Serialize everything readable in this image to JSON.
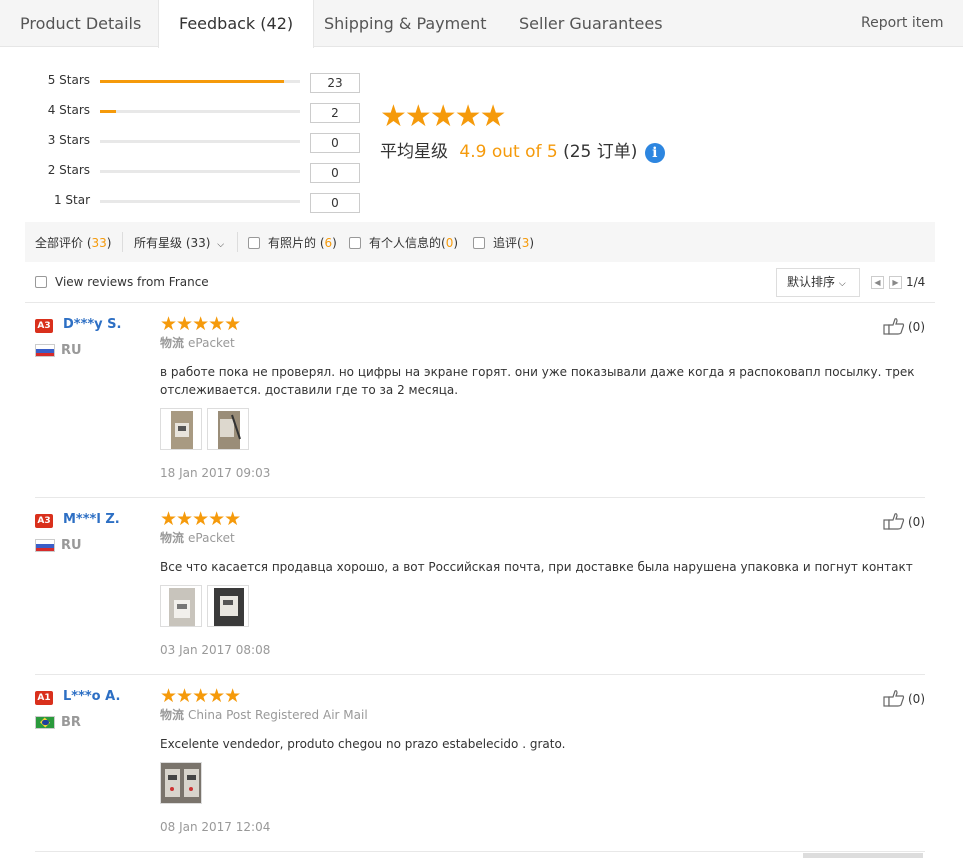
{
  "tabs": {
    "product_details": "Product Details",
    "feedback": "Feedback (42)",
    "shipping": "Shipping & Payment",
    "seller": "Seller Guarantees",
    "report": "Report item"
  },
  "rating_summary": {
    "rows": [
      {
        "label": "5 Stars",
        "count": "23",
        "fill_fraction": 0.92
      },
      {
        "label": "4 Stars",
        "count": "2",
        "fill_fraction": 0.08
      },
      {
        "label": "3 Stars",
        "count": "0",
        "fill_fraction": 0
      },
      {
        "label": "2 Stars",
        "count": "0",
        "fill_fraction": 0
      },
      {
        "label": "1 Star",
        "count": "0",
        "fill_fraction": 0
      }
    ],
    "stars_glyph": "★★★★★",
    "avg_label": "平均星级",
    "avg_score": "4.9 out of 5",
    "avg_orders": "(25 订单)",
    "info_glyph": "i"
  },
  "filters": {
    "all_label": "全部评价 (",
    "all_count": "33",
    "all_close": ")",
    "stars_select": "所有星级 (33)",
    "photos_label": "有照片的 (",
    "photos_count": "6",
    "photos_close": ")",
    "personal_label": "有个人信息的(",
    "personal_count": "0",
    "personal_close": ")",
    "followup_label": "追评(",
    "followup_count": "3",
    "followup_close": ")"
  },
  "sort": {
    "france_label": "View reviews from France",
    "sort_label": "默认排序",
    "prev_glyph": "◀",
    "next_glyph": "▶",
    "page_text": "1/4"
  },
  "reviews": [
    {
      "level": "A3",
      "user": "D***y S.",
      "country": "RU",
      "stars": "★★★★★",
      "logistics_label": "物流",
      "logistics": "ePacket",
      "text": "в работе пока не проверял. но цифры на экране горят. они уже показывали даже когда я распоковапл посылку. трек отслеживается. доставили где то за 2 месяца.",
      "date": "18 Jan 2017 09:03",
      "likes": "(0)"
    },
    {
      "level": "A3",
      "user": "M***l Z.",
      "country": "RU",
      "stars": "★★★★★",
      "logistics_label": "物流",
      "logistics": "ePacket",
      "text": "Все что касается продавца хорошо, а вот Российская почта, при доставке была нарушена упаковка и погнут контакт",
      "date": "03 Jan 2017 08:08",
      "likes": "(0)"
    },
    {
      "level": "A1",
      "user": "L***o A.",
      "country": "BR",
      "stars": "★★★★★",
      "logistics_label": "物流",
      "logistics": "China Post Registered Air Mail",
      "text": "Excelente vendedor, produto chegou no prazo estabelecido . grato.",
      "date": "08 Jan 2017 12:04",
      "likes": "(0)"
    }
  ],
  "colors": {
    "accent": "#f59a0b",
    "link": "#2d6fc4",
    "level_badge": "#d9301c",
    "info": "#2d86e0"
  }
}
